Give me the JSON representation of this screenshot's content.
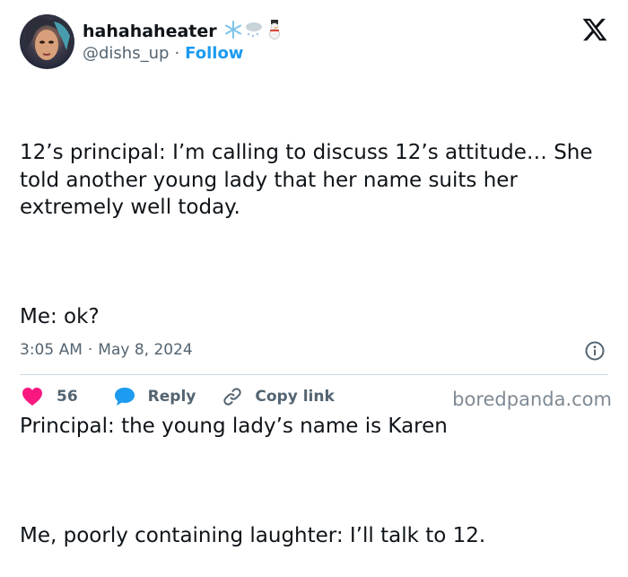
{
  "tweet": {
    "display_name": "hahahaheater",
    "name_emojis": [
      "snowflake-icon",
      "cloud-snow-icon",
      "snowman-icon"
    ],
    "handle": "@dishs_up",
    "separator": "·",
    "follow_label": "Follow",
    "paragraphs": [
      "12’s principal: I’m calling to discuss 12’s attitude… She told another young lady that her name suits her extremely well today.",
      "Me: ok?",
      "Principal: the young lady’s name is Karen",
      "Me, poorly containing laughter: I’ll talk to 12."
    ],
    "time": "3:05 AM",
    "date": "May 8, 2024"
  },
  "actions": {
    "likes_count": "56",
    "reply_label": "Reply",
    "copy_link_label": "Copy link"
  },
  "watermark": "boredpanda.com",
  "colors": {
    "text": "#0f1419",
    "secondary": "#536471",
    "link": "#1d9bf0",
    "heart": "#f91880",
    "divider": "#cfd9de"
  }
}
